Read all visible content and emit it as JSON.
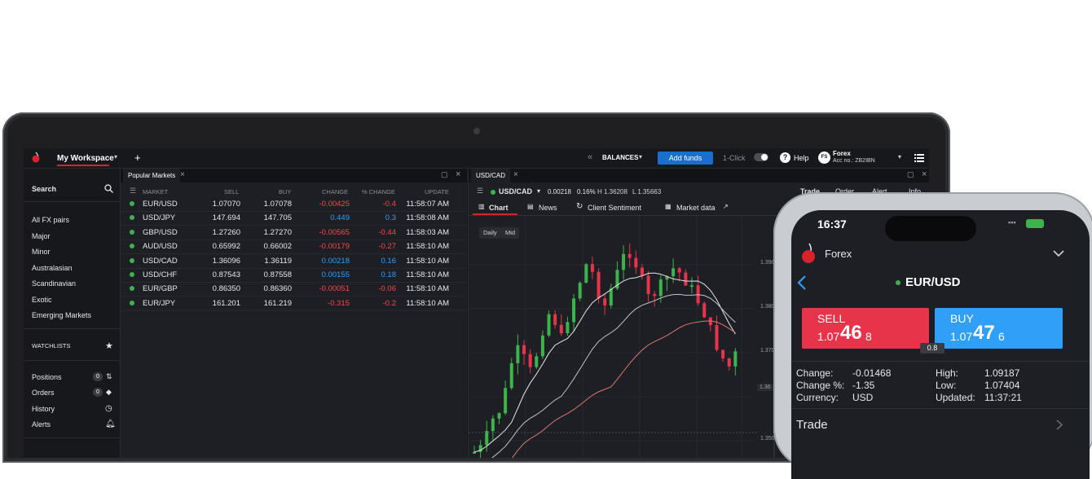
{
  "desktop": {
    "workspace_title": "My Workspace",
    "add_tab": "+",
    "collapse": "«",
    "balances": "BALANCES",
    "add_funds": "Add funds",
    "one_click": "1-Click",
    "help": "Help",
    "avatar": "FS",
    "account_name": "Forex",
    "account_no": "Acc no.: ZB2IBN",
    "sidebar": {
      "search": "Search",
      "categories": [
        "All FX pairs",
        "Major",
        "Minor",
        "Australasian",
        "Scandinavian",
        "Exotic",
        "Emerging Markets"
      ],
      "watchlists": "WATCHLISTS",
      "positions": "Positions",
      "positions_count": "0",
      "orders": "Orders",
      "orders_count": "0",
      "history": "History",
      "alerts": "Alerts"
    },
    "market_panel": {
      "tab": "Popular Markets",
      "headers": {
        "market": "MARKET",
        "sell": "SELL",
        "buy": "BUY",
        "change": "CHANGE",
        "pct": "% CHANGE",
        "update": "UPDATE"
      },
      "rows": [
        {
          "market": "EUR/USD",
          "sell": "1.07070",
          "buy": "1.07078",
          "change": "-0.00425",
          "pct": "-0.4",
          "update": "11:58:07 AM"
        },
        {
          "market": "USD/JPY",
          "sell": "147.694",
          "buy": "147.705",
          "change": "0.449",
          "pct": "0.3",
          "update": "11:58:08 AM"
        },
        {
          "market": "GBP/USD",
          "sell": "1.27260",
          "buy": "1.27270",
          "change": "-0.00565",
          "pct": "-0.44",
          "update": "11:58:03 AM"
        },
        {
          "market": "AUD/USD",
          "sell": "0.65992",
          "buy": "0.66002",
          "change": "-0.00179",
          "pct": "-0.27",
          "update": "11:58:10 AM"
        },
        {
          "market": "USD/CAD",
          "sell": "1.36096",
          "buy": "1.36119",
          "change": "0.00218",
          "pct": "0.16",
          "update": "11:58:10 AM"
        },
        {
          "market": "USD/CHF",
          "sell": "0.87543",
          "buy": "0.87558",
          "change": "0.00155",
          "pct": "0.18",
          "update": "11:58:10 AM"
        },
        {
          "market": "EUR/GBP",
          "sell": "0.86350",
          "buy": "0.86360",
          "change": "-0.00051",
          "pct": "-0.06",
          "update": "11:58:10 AM"
        },
        {
          "market": "EUR/JPY",
          "sell": "161.201",
          "buy": "161.219",
          "change": "-0.315",
          "pct": "-0.2",
          "update": "11:58:10 AM"
        }
      ]
    },
    "chart_panel": {
      "tab": "USD/CAD",
      "instrument": "USD/CAD",
      "change": "0.00218",
      "pct": "0.16%",
      "high": "H 1.36208",
      "low": "L 1.35663",
      "tabs": [
        "Chart",
        "News",
        "Client Sentiment",
        "Market data"
      ],
      "right_tabs": [
        "Trade",
        "Order",
        "Alert",
        "Info"
      ],
      "chips": [
        "Daily",
        "Mid"
      ],
      "price_labels": [
        "1.390",
        "1.380",
        "1.370",
        "1.36",
        "1.350"
      ]
    }
  },
  "phone": {
    "time": "16:37",
    "account": "Forex",
    "instrument": "EUR/USD",
    "sell_label": "SELL",
    "sell_prefix": "1.07",
    "sell_big": "46",
    "sell_suffix": "8",
    "buy_label": "BUY",
    "buy_prefix": "1.07",
    "buy_big": "47",
    "buy_suffix": "6",
    "spread": "0.8",
    "info": {
      "change_label": "Change:",
      "change_value": "-0.01468",
      "change_pct_label": "Change %:",
      "change_pct_value": "-1.35",
      "currency_label": "Currency:",
      "currency_value": "USD",
      "high_label": "High:",
      "high_value": "1.09187",
      "low_label": "Low:",
      "low_value": "1.07404",
      "updated_label": "Updated:",
      "updated_value": "11:37:21"
    },
    "trade": "Trade"
  },
  "colors": {
    "up": "#3cb44b",
    "down": "#e8344a",
    "accent": "#1c6dd0",
    "brand": "#d4232b"
  }
}
